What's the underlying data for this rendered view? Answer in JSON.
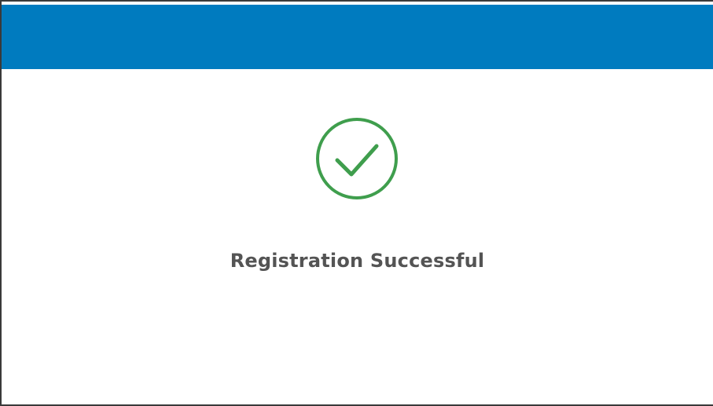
{
  "dialog": {
    "header_color": "#007bbf",
    "status_icon": "check-circle-icon",
    "status_icon_color": "#3f9e4d",
    "message": "Registration Successful"
  }
}
